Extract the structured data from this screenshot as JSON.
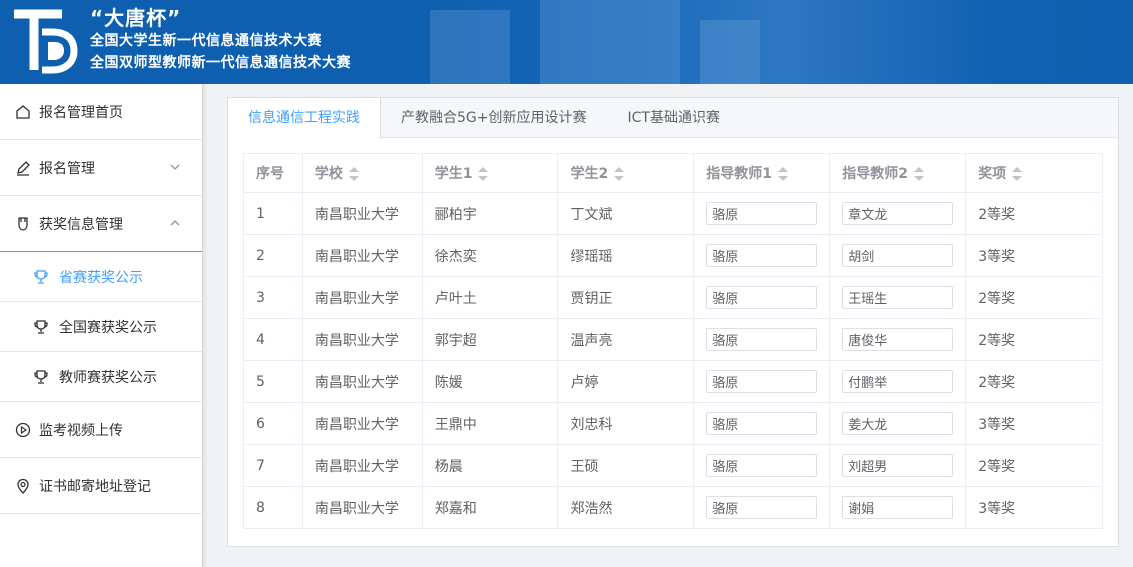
{
  "header": {
    "title": "“大唐杯”",
    "line1": "全国大学生新一代信息通信技术大赛",
    "line2": "全国双师型教师新一代信息通信技术大赛"
  },
  "sidebar": {
    "items": [
      {
        "label": "报名管理首页",
        "icon": "home-icon"
      },
      {
        "label": "报名管理",
        "icon": "edit-icon"
      },
      {
        "label": "获奖信息管理",
        "icon": "medal-icon"
      },
      {
        "label": "监考视频上传",
        "icon": "play-icon"
      },
      {
        "label": "证书邮寄地址登记",
        "icon": "location-icon"
      }
    ],
    "sub_items": [
      {
        "label": "省赛获奖公示",
        "icon": "trophy-icon"
      },
      {
        "label": "全国赛获奖公示",
        "icon": "trophy-icon"
      },
      {
        "label": "教师赛获奖公示",
        "icon": "trophy-icon"
      }
    ]
  },
  "tabs": [
    "信息通信工程实践",
    "产教融合5G+创新应用设计赛",
    "ICT基础通识赛"
  ],
  "table": {
    "headers": [
      "序号",
      "学校",
      "学生1",
      "学生2",
      "指导教师1",
      "指导教师2",
      "奖项"
    ],
    "rows": [
      [
        "1",
        "南昌职业大学",
        "郦柏宇",
        "丁文斌",
        "骆原",
        "章文龙",
        "2等奖"
      ],
      [
        "2",
        "南昌职业大学",
        "徐杰奕",
        "缪瑶瑶",
        "骆原",
        "胡剑",
        "3等奖"
      ],
      [
        "3",
        "南昌职业大学",
        "卢叶土",
        "贾钥正",
        "骆原",
        "王瑶生",
        "2等奖"
      ],
      [
        "4",
        "南昌职业大学",
        "郭宇超",
        "温声亮",
        "骆原",
        "唐俊华",
        "2等奖"
      ],
      [
        "5",
        "南昌职业大学",
        "陈媛",
        "卢婷",
        "骆原",
        "付鹏举",
        "2等奖"
      ],
      [
        "6",
        "南昌职业大学",
        "王鼎中",
        "刘忠科",
        "骆原",
        "姜大龙",
        "3等奖"
      ],
      [
        "7",
        "南昌职业大学",
        "杨晨",
        "王硕",
        "骆原",
        "刘超男",
        "2等奖"
      ],
      [
        "8",
        "南昌职业大学",
        "郑嘉和",
        "郑浩然",
        "骆原",
        "谢娟",
        "3等奖"
      ]
    ]
  }
}
